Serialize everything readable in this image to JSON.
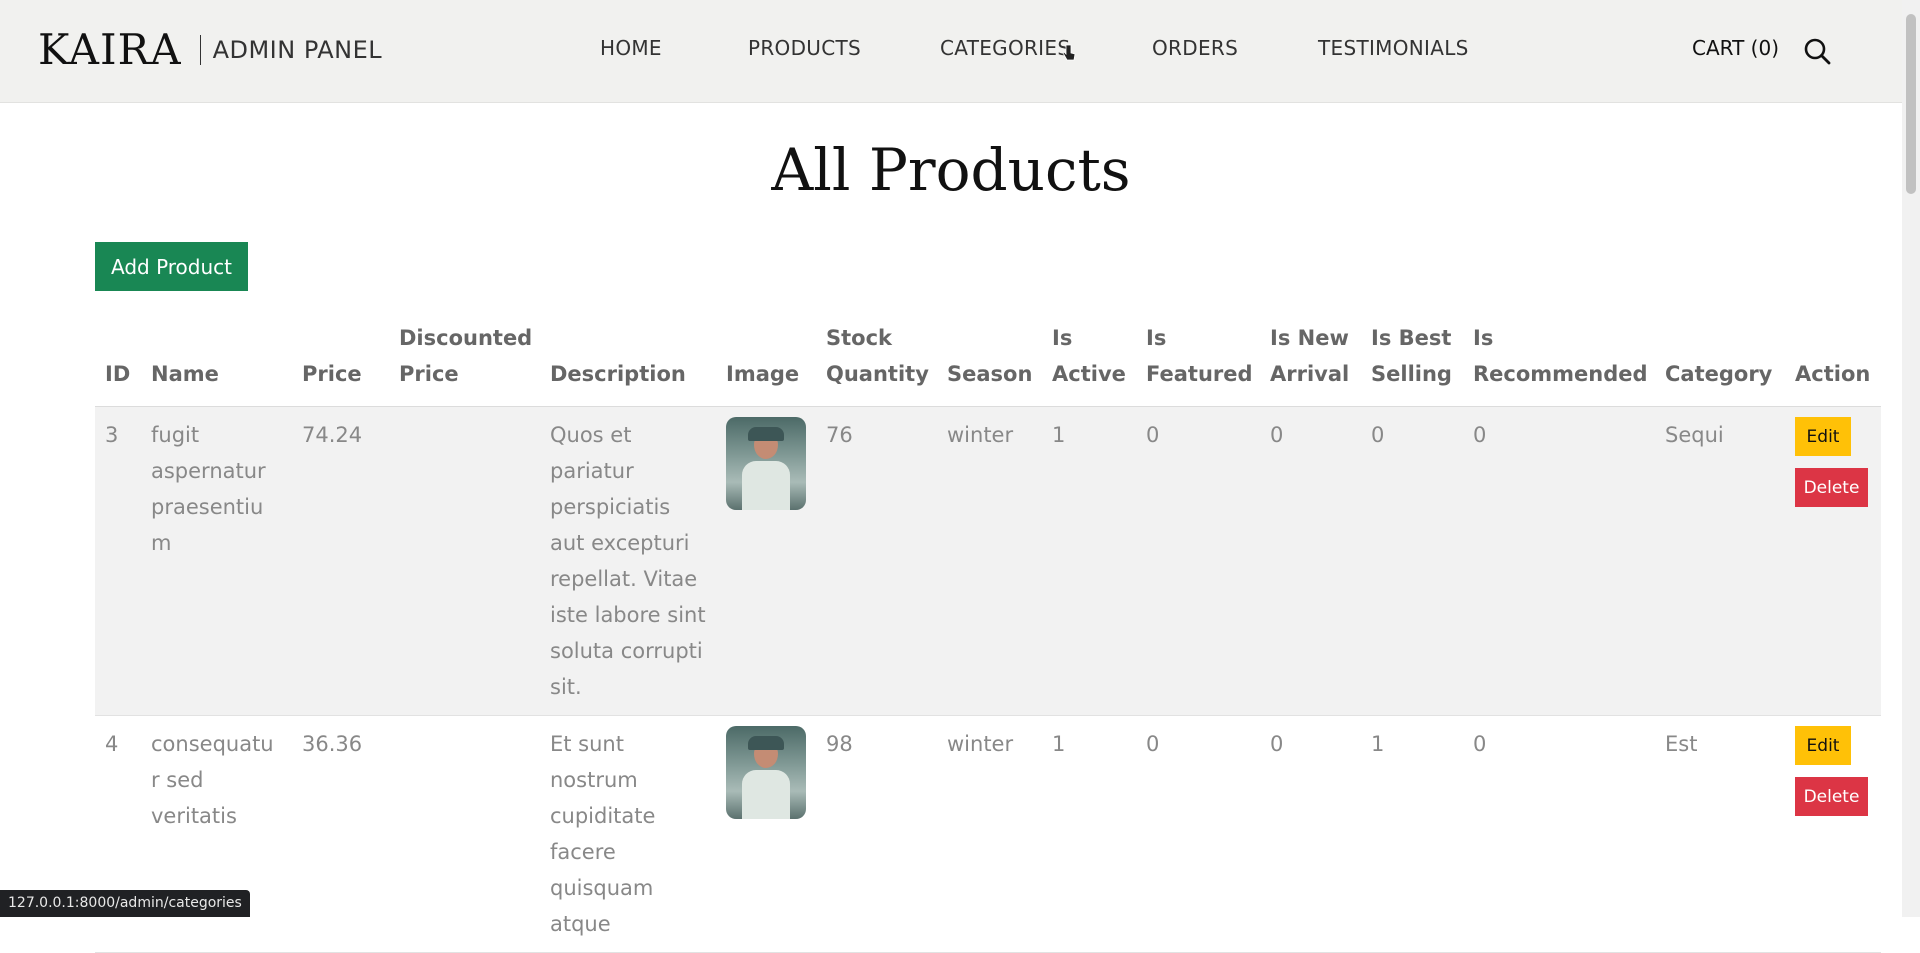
{
  "header": {
    "logo": "KAIRA",
    "subtitle": "ADMIN PANEL",
    "nav": [
      "HOME",
      "PRODUCTS",
      "CATEGORIES",
      "ORDERS",
      "TESTIMONIALS"
    ],
    "cart_label": "CART (0)"
  },
  "main": {
    "title": "All Products",
    "add_button": "Add Product"
  },
  "table": {
    "columns": [
      "ID",
      "Name",
      "Price",
      "Discounted Price",
      "Description",
      "Image",
      "Stock Quantity",
      "Season",
      "Is Active",
      "Is Featured",
      "Is New Arrival",
      "Is Best Selling",
      "Is Recommended",
      "Category",
      "Action"
    ],
    "rows": [
      {
        "id": "3",
        "name": "fugit aspernatur praesentium",
        "price": "74.24",
        "discounted_price": "",
        "description": "Quos et pariatur perspiciatis aut excepturi repellat. Vitae iste labore sint soluta corrupti sit.",
        "stock": "76",
        "season": "winter",
        "is_active": "1",
        "is_featured": "0",
        "is_new_arrival": "0",
        "is_best_selling": "0",
        "is_recommended": "0",
        "category": "Sequi",
        "edit_label": "Edit",
        "delete_label": "Delete"
      },
      {
        "id": "4",
        "name": "consequatur sed veritatis",
        "price": "36.36",
        "discounted_price": "",
        "description": "Et sunt nostrum cupiditate facere quisquam atque",
        "stock": "98",
        "season": "winter",
        "is_active": "1",
        "is_featured": "0",
        "is_new_arrival": "0",
        "is_best_selling": "1",
        "is_recommended": "0",
        "category": "Est",
        "edit_label": "Edit",
        "delete_label": "Delete"
      }
    ]
  },
  "status_bar": {
    "url": "127.0.0.1:8000/admin/categories"
  },
  "colors": {
    "add": "#198754",
    "edit": "#ffc107",
    "delete": "#dc3545",
    "header_bg": "#f1f1ef"
  }
}
